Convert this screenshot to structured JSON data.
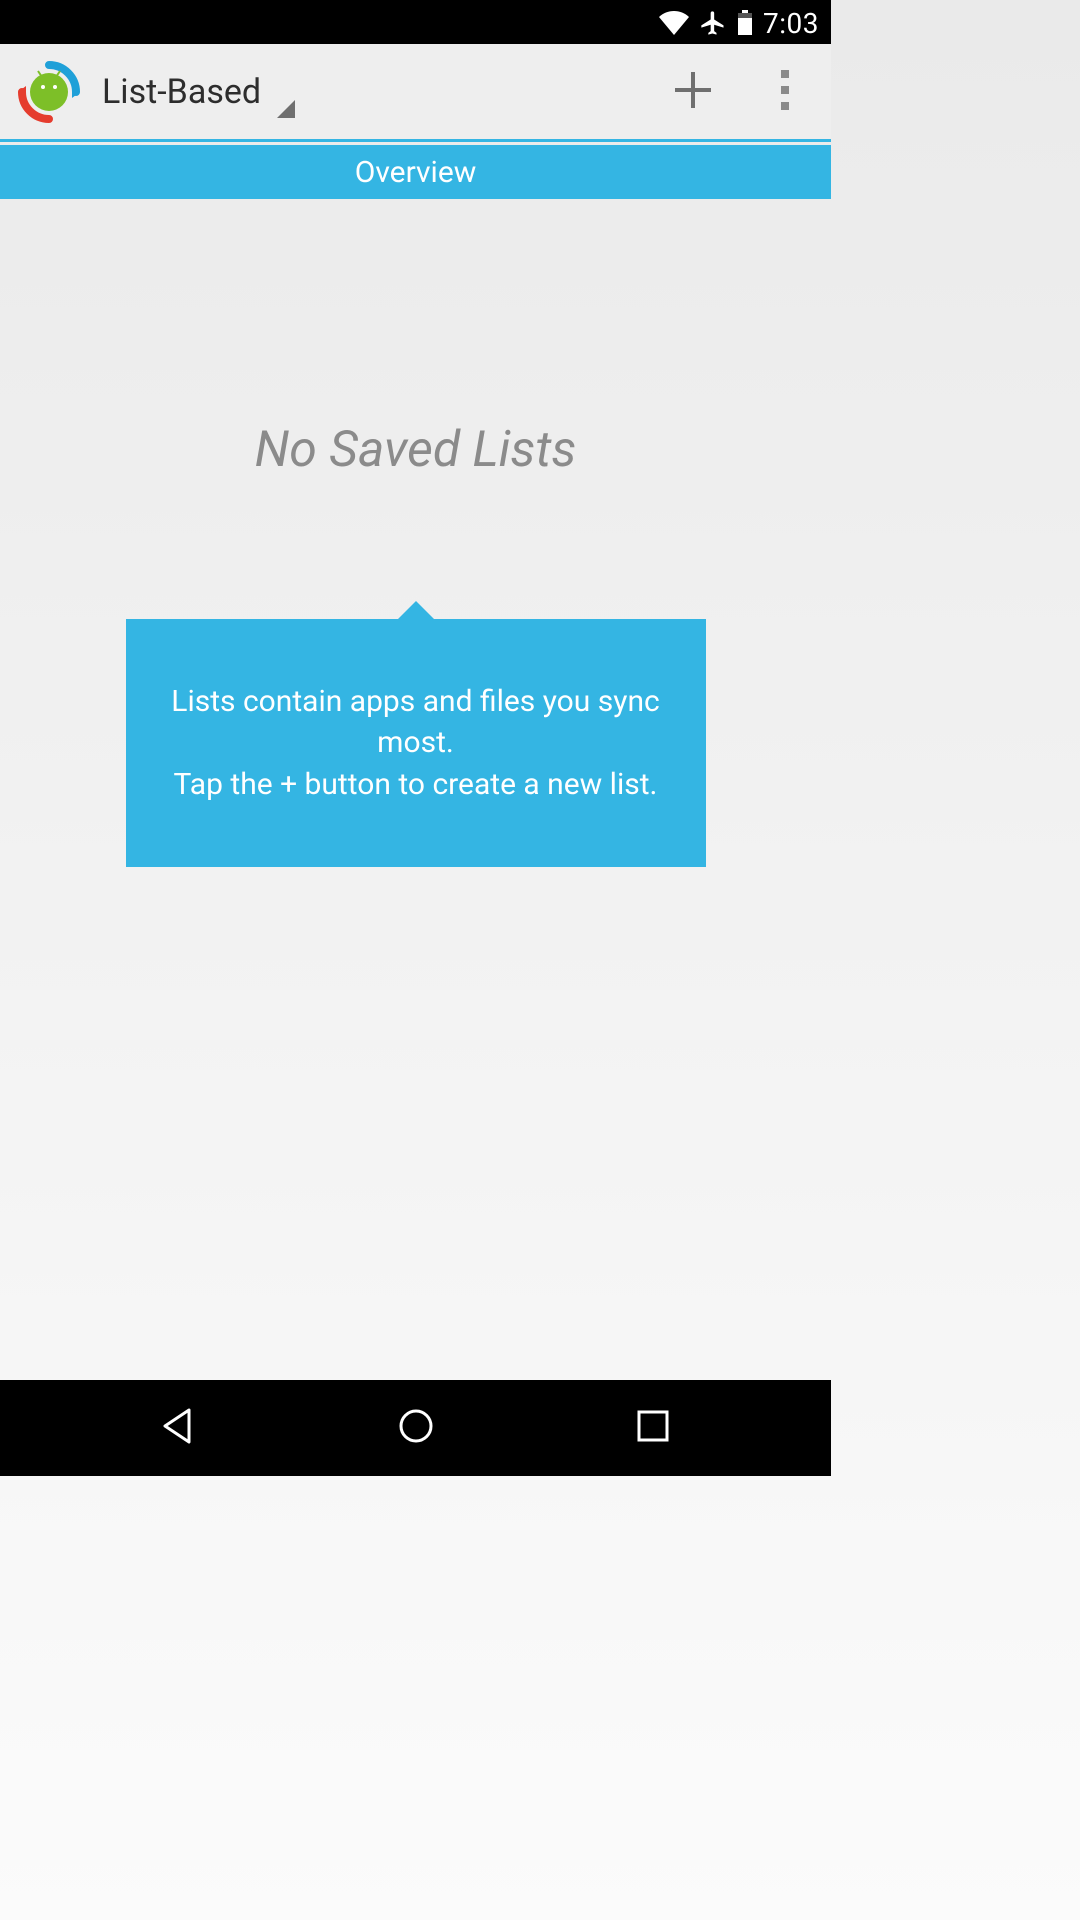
{
  "status": {
    "time": "7:03"
  },
  "actionbar": {
    "title": "List-Based"
  },
  "tabs": {
    "overview": "Overview"
  },
  "empty": {
    "title": "No Saved Lists",
    "hint": "Lists contain apps and files you sync most.\nTap the + button to create a new list."
  },
  "icons": {
    "wifi": "wifi-icon",
    "airplane": "airplane-mode-icon",
    "battery": "battery-icon",
    "add": "plus-icon",
    "overflow": "more-vert-icon",
    "back": "back-icon",
    "home": "home-icon",
    "recent": "recent-apps-icon"
  }
}
